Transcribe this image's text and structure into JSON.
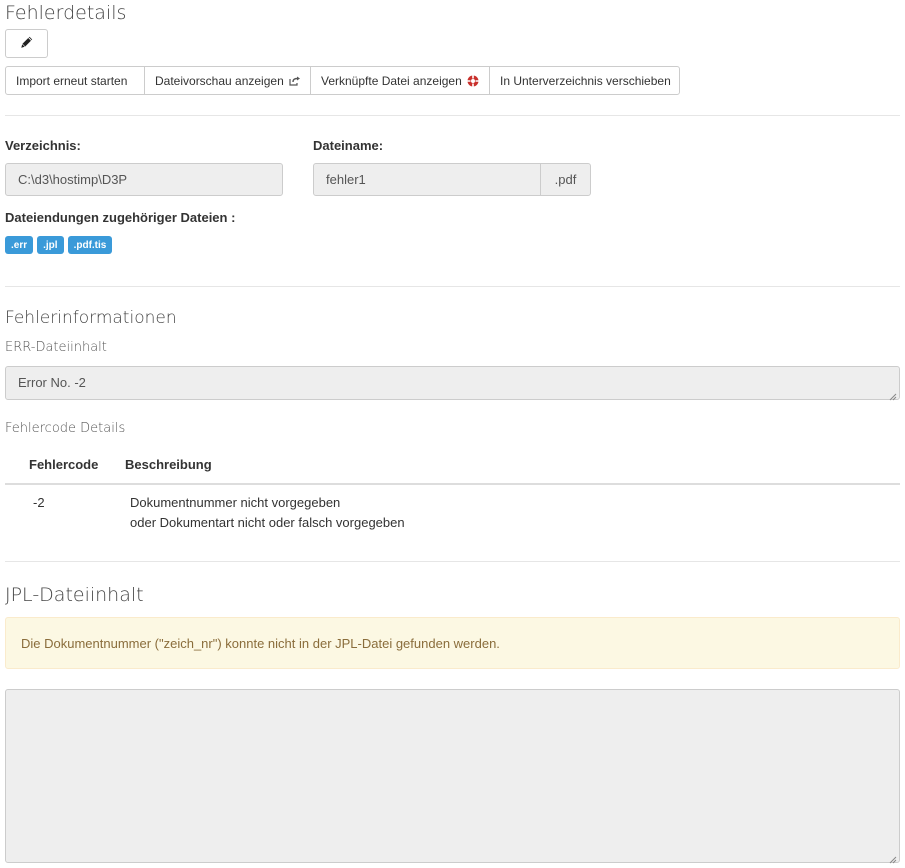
{
  "page_title": "Fehlerdetails",
  "edit_icon": "pencil-icon",
  "toolbar": {
    "import_label": "Import erneut starten",
    "preview_label": "Dateivorschau anzeigen",
    "preview_icon": "external-link-icon",
    "linked_label": "Verknüpfte Datei anzeigen",
    "linked_icon": "lifebuoy-icon",
    "linked_icon_color": "#c9302c",
    "move_label": "In Unterverzeichnis verschieben"
  },
  "file": {
    "dir_label": "Verzeichnis:",
    "dir_value": "C:\\d3\\hostimp\\D3P",
    "name_label": "Dateiname:",
    "name_value": "fehler1",
    "extension": ".pdf",
    "related_label": "Dateiendungen zugehöriger Dateien :",
    "related_extensions": [
      ".err",
      ".jpl",
      ".pdf.tis"
    ],
    "badge_color": "#3a9ad9"
  },
  "errors": {
    "heading": "Fehlerinformationen",
    "err_label": "ERR-Dateiinhalt",
    "err_content": "Error No. -2",
    "codes_label": "Fehlercode Details",
    "table": {
      "headers": [
        "Fehlercode",
        "Beschreibung"
      ],
      "rows": [
        {
          "code": "-2",
          "desc_line1": "Dokumentnummer nicht vorgegeben",
          "desc_line2": "oder Dokumentart nicht oder falsch vorgegeben"
        }
      ]
    }
  },
  "jpl": {
    "heading": "JPL-Dateiinhalt",
    "warning": "Die Dokumentnummer (\"zeich_nr\") konnte nicht in der JPL-Datei gefunden werden.",
    "warning_bg": "#fcf8e3",
    "content": ""
  }
}
